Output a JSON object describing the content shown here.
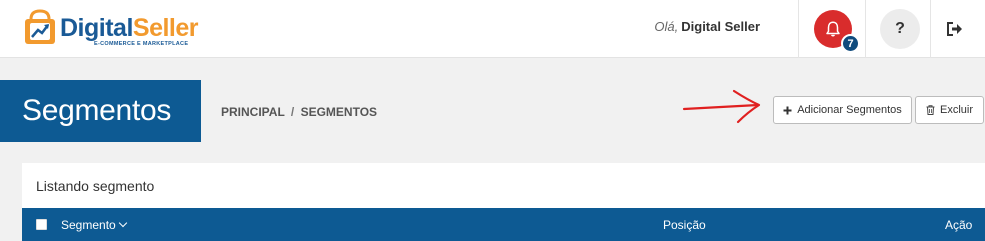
{
  "header": {
    "logo": {
      "name_part1": "Digital",
      "name_part2": "Seller",
      "tagline": "E-COMMERCE E MARKETPLACE"
    },
    "greeting": {
      "hello": "Olá,",
      "user_name": "Digital Seller"
    },
    "notifications": {
      "icon": "bell-icon",
      "count": "7",
      "color": "#d92c2c"
    },
    "help": {
      "label": "?"
    },
    "logout": {
      "icon": "sign-out-icon"
    }
  },
  "page": {
    "title": "Segmentos",
    "breadcrumb": {
      "root": "PRINCIPAL",
      "separator": "/",
      "current": "SEGMENTOS"
    },
    "actions": {
      "add_label": "Adicionar Segmentos",
      "add_icon": "plus-icon",
      "delete_label": "Excluir",
      "delete_icon": "trash-icon"
    }
  },
  "list": {
    "title": "Listando segmento",
    "columns": [
      "Segmento",
      "Posição",
      "Ação"
    ]
  },
  "colors": {
    "primary": "#0d5a93",
    "accent_orange": "#f29a2e",
    "alert_red": "#d92c2c"
  }
}
